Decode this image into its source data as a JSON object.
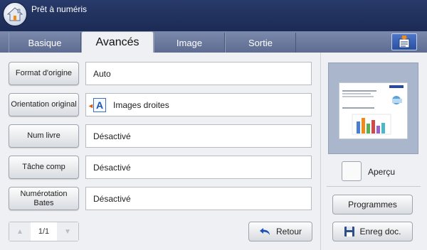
{
  "app": {
    "title": "Prêt à numéris"
  },
  "tabs": [
    {
      "label": "Basique",
      "active": false
    },
    {
      "label": "Avancés",
      "active": true
    },
    {
      "label": "Image",
      "active": false
    },
    {
      "label": "Sortie",
      "active": false
    }
  ],
  "options": [
    {
      "label": "Format d'origine",
      "value": "Auto"
    },
    {
      "label": "Orientation original",
      "value": "Images droites",
      "icon": "orientation-portrait-icon"
    },
    {
      "label": "Num livre",
      "value": "Désactivé"
    },
    {
      "label": "Tâche comp",
      "value": "Désactivé"
    },
    {
      "label": "Numérotation Bates",
      "value": "Désactivé"
    }
  ],
  "pager": {
    "count": "1/1"
  },
  "buttons": {
    "back": "Retour",
    "preview": "Aperçu",
    "programs": "Programmes",
    "save_doc": "Enreg doc."
  },
  "colors": {
    "title_bar": "#1c2b55",
    "tab_bar": "#6b7a9c",
    "accent_blue": "#2a4fa0",
    "panel": "#eef0f3"
  }
}
